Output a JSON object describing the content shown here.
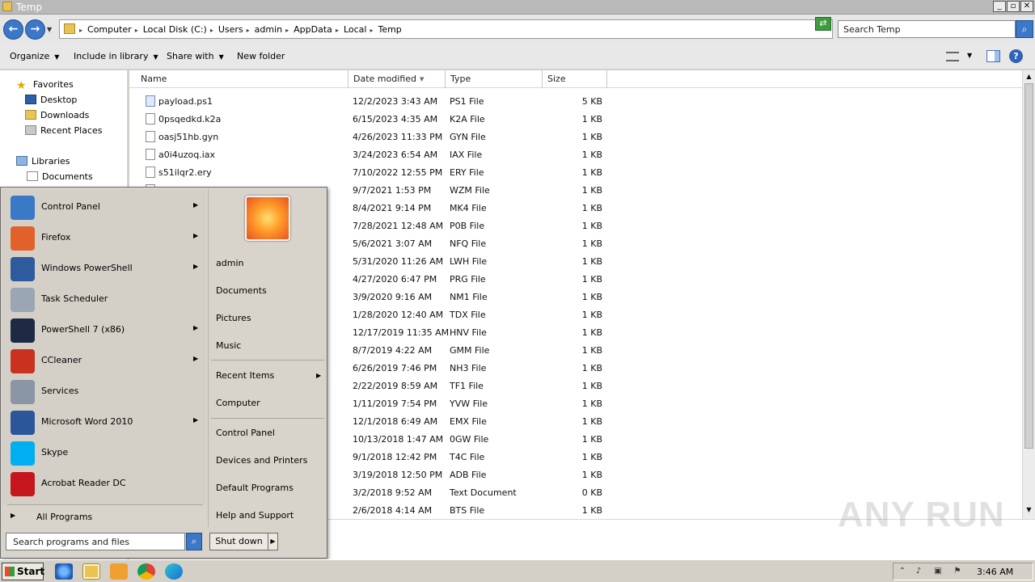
{
  "window": {
    "title": "Temp"
  },
  "address": {
    "crumbs": [
      "Computer",
      "Local Disk (C:)",
      "Users",
      "admin",
      "AppData",
      "Local",
      "Temp"
    ],
    "search_placeholder": "Search Temp"
  },
  "toolbar": {
    "organize": "Organize",
    "include_in_library": "Include in library",
    "share_with": "Share with",
    "new_folder": "New folder"
  },
  "nav": {
    "favorites": "Favorites",
    "desktop": "Desktop",
    "downloads": "Downloads",
    "recent_places": "Recent Places",
    "libraries": "Libraries",
    "documents": "Documents"
  },
  "columns": {
    "name": "Name",
    "date": "Date modified",
    "type": "Type",
    "size": "Size"
  },
  "files": [
    {
      "name": "payload.ps1",
      "date": "12/2/2023 3:43 AM",
      "type": "PS1 File",
      "size": "5 KB"
    },
    {
      "name": "0psqedkd.k2a",
      "date": "6/15/2023 4:35 AM",
      "type": "K2A File",
      "size": "1 KB"
    },
    {
      "name": "oasj51hb.gyn",
      "date": "4/26/2023 11:33 PM",
      "type": "GYN File",
      "size": "1 KB"
    },
    {
      "name": "a0i4uzoq.iax",
      "date": "3/24/2023 6:54 AM",
      "type": "IAX File",
      "size": "1 KB"
    },
    {
      "name": "s51ilqr2.ery",
      "date": "7/10/2022 12:55 PM",
      "type": "ERY File",
      "size": "1 KB"
    },
    {
      "name": "",
      "date": "9/7/2021 1:53 PM",
      "type": "WZM File",
      "size": "1 KB"
    },
    {
      "name": "",
      "date": "8/4/2021 9:14 PM",
      "type": "MK4 File",
      "size": "1 KB"
    },
    {
      "name": "",
      "date": "7/28/2021 12:48 AM",
      "type": "P0B File",
      "size": "1 KB"
    },
    {
      "name": "",
      "date": "5/6/2021 3:07 AM",
      "type": "NFQ File",
      "size": "1 KB"
    },
    {
      "name": "",
      "date": "5/31/2020 11:26 AM",
      "type": "LWH File",
      "size": "1 KB"
    },
    {
      "name": "",
      "date": "4/27/2020 6:47 PM",
      "type": "PRG File",
      "size": "1 KB"
    },
    {
      "name": "",
      "date": "3/9/2020 9:16 AM",
      "type": "NM1 File",
      "size": "1 KB"
    },
    {
      "name": "",
      "date": "1/28/2020 12:40 AM",
      "type": "TDX File",
      "size": "1 KB"
    },
    {
      "name": "",
      "date": "12/17/2019 11:35 AM",
      "type": "HNV File",
      "size": "1 KB"
    },
    {
      "name": "",
      "date": "8/7/2019 4:22 AM",
      "type": "GMM File",
      "size": "1 KB"
    },
    {
      "name": "",
      "date": "6/26/2019 7:46 PM",
      "type": "NH3 File",
      "size": "1 KB"
    },
    {
      "name": "",
      "date": "2/22/2019 8:59 AM",
      "type": "TF1 File",
      "size": "1 KB"
    },
    {
      "name": "",
      "date": "1/11/2019 7:54 PM",
      "type": "YVW File",
      "size": "1 KB"
    },
    {
      "name": "",
      "date": "12/1/2018 6:49 AM",
      "type": "EMX File",
      "size": "1 KB"
    },
    {
      "name": "",
      "date": "10/13/2018 1:47 AM",
      "type": "0GW File",
      "size": "1 KB"
    },
    {
      "name": "",
      "date": "9/1/2018 12:42 PM",
      "type": "T4C File",
      "size": "1 KB"
    },
    {
      "name": "",
      "date": "3/19/2018 12:50 PM",
      "type": "ADB File",
      "size": "1 KB"
    },
    {
      "name": "",
      "date": "3/2/2018 9:52 AM",
      "type": "Text Document",
      "size": "0 KB"
    },
    {
      "name": "",
      "date": "2/6/2018 4:14 AM",
      "type": "BTS File",
      "size": "1 KB"
    }
  ],
  "start_menu": {
    "programs": [
      {
        "label": "Control Panel",
        "icon": "control-panel-icon",
        "color": "#3a78c8",
        "has_arrow": true
      },
      {
        "label": "Firefox",
        "icon": "firefox-icon",
        "color": "#e0622a",
        "has_arrow": true
      },
      {
        "label": "Windows PowerShell",
        "icon": "powershell-icon",
        "color": "#2d5b9e",
        "has_arrow": true
      },
      {
        "label": "Task Scheduler",
        "icon": "task-scheduler-icon",
        "color": "#9aa6b4",
        "has_arrow": false
      },
      {
        "label": "PowerShell 7 (x86)",
        "icon": "powershell7-icon",
        "color": "#1e2a44",
        "has_arrow": true
      },
      {
        "label": "CCleaner",
        "icon": "ccleaner-icon",
        "color": "#c8321e",
        "has_arrow": true
      },
      {
        "label": "Services",
        "icon": "services-icon",
        "color": "#8a96a6",
        "has_arrow": false
      },
      {
        "label": "Microsoft Word 2010",
        "icon": "word-icon",
        "color": "#2b579a",
        "has_arrow": true
      },
      {
        "label": "Skype",
        "icon": "skype-icon",
        "color": "#00aff0",
        "has_arrow": false
      },
      {
        "label": "Acrobat Reader DC",
        "icon": "acrobat-icon",
        "color": "#c4161c",
        "has_arrow": false
      }
    ],
    "all_programs": "All Programs",
    "search_placeholder": "Search programs and files",
    "right_links": {
      "user": "admin",
      "documents": "Documents",
      "pictures": "Pictures",
      "music": "Music",
      "recent_items": "Recent Items",
      "computer": "Computer",
      "control_panel": "Control Panel",
      "devices_printers": "Devices and Printers",
      "default_programs": "Default Programs",
      "help_support": "Help and Support"
    },
    "shutdown": "Shut down"
  },
  "taskbar": {
    "start": "Start",
    "clock": "3:46 AM"
  },
  "watermark": "ANY RUN"
}
